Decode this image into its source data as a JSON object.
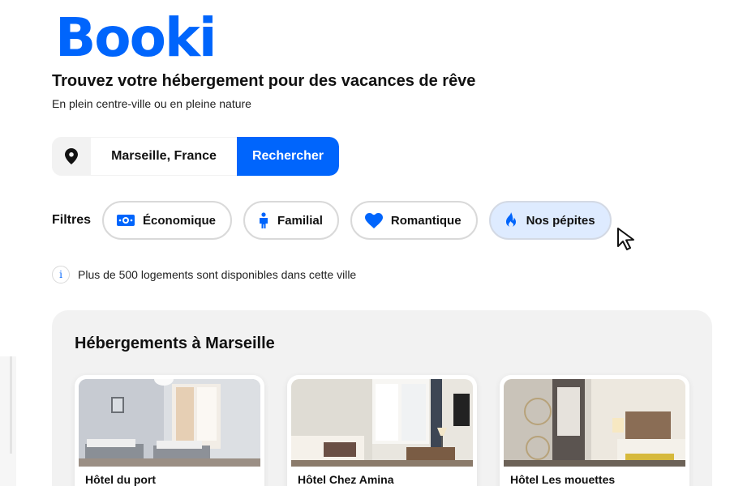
{
  "brand": {
    "logo_text": "Booki",
    "color": "#0065fc"
  },
  "hero": {
    "title": "Trouvez votre hébergement pour des vacances de rêve",
    "subtitle": "En plein centre-ville ou en pleine nature"
  },
  "search": {
    "location_icon": "location-pin-icon",
    "city_value": "Marseille, France",
    "button_label": "Rechercher"
  },
  "filters": {
    "label": "Filtres",
    "chips": [
      {
        "label": "Économique",
        "icon": "money-icon",
        "active": false
      },
      {
        "label": "Familial",
        "icon": "person-icon",
        "active": false
      },
      {
        "label": "Romantique",
        "icon": "heart-icon",
        "active": false
      },
      {
        "label": "Nos pépites",
        "icon": "flame-icon",
        "active": true
      }
    ]
  },
  "info": {
    "icon": "info-icon",
    "text": "Plus de 500 logements sont disponibles dans cette ville"
  },
  "listings": {
    "title": "Hébergements à Marseille",
    "cards": [
      {
        "name": "Hôtel du port"
      },
      {
        "name": "Hôtel Chez Amina"
      },
      {
        "name": "Hôtel Les mouettes"
      }
    ]
  },
  "colors": {
    "accent": "#0065fc",
    "active_chip_bg": "#deebff",
    "panel_bg": "#f2f2f2"
  }
}
